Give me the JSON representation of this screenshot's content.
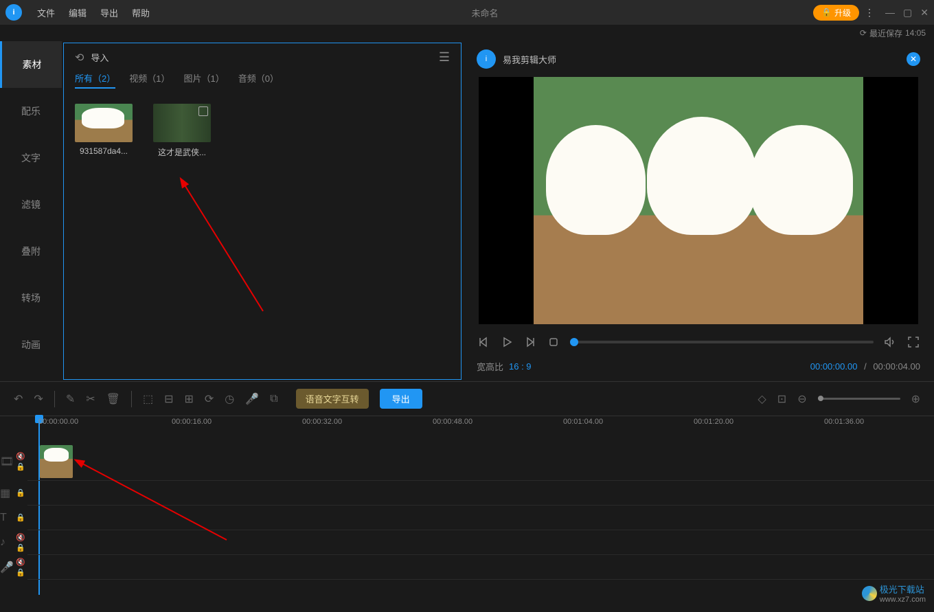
{
  "titlebar": {
    "logo": "易",
    "menus": [
      "文件",
      "编辑",
      "导出",
      "帮助"
    ],
    "title": "未命名",
    "upgrade": "升级",
    "last_save_label": "最近保存",
    "last_save_time": "14:05"
  },
  "sidebar": {
    "items": [
      "素材",
      "配乐",
      "文字",
      "滤镜",
      "叠附",
      "转场",
      "动画"
    ]
  },
  "media_panel": {
    "import_label": "导入",
    "tabs": [
      {
        "label": "所有（2）",
        "active": true
      },
      {
        "label": "视频（1）",
        "active": false
      },
      {
        "label": "图片（1）",
        "active": false
      },
      {
        "label": "音频（0）",
        "active": false
      }
    ],
    "items": [
      {
        "name": "931587da4..."
      },
      {
        "name": "这才是武侠..."
      }
    ]
  },
  "preview": {
    "app_name": "易我剪辑大师",
    "aspect_label": "宽高比",
    "aspect_value": "16 : 9",
    "time_current": "00:00:00.00",
    "time_total": "00:00:04.00"
  },
  "toolbar": {
    "voice_convert": "语音文字互转",
    "export": "导出"
  },
  "timeline": {
    "marks": [
      "00:00:00.00",
      "00:00:16.00",
      "00:00:32.00",
      "00:00:48.00",
      "00:01:04.00",
      "00:01:20.00",
      "00:01:36.00"
    ]
  },
  "watermark": {
    "text": "极光下载站",
    "url": "www.xz7.com"
  }
}
